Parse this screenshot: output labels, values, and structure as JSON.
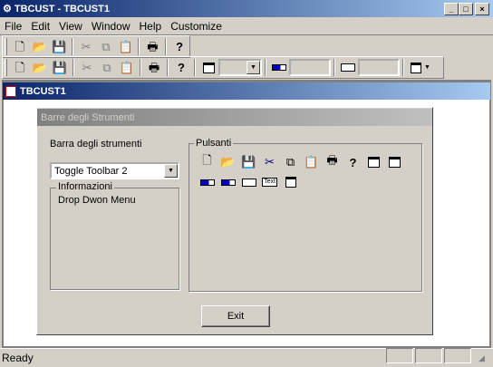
{
  "window": {
    "title": "TBCUST - TBCUST1",
    "min": "_",
    "max": "□",
    "close": "×"
  },
  "menu": [
    "File",
    "Edit",
    "View",
    "Window",
    "Help",
    "Customize"
  ],
  "toolbar1": {
    "icons": [
      "new-icon",
      "open-icon",
      "save-icon",
      "cut-icon",
      "copy-icon",
      "paste-icon",
      "print-icon",
      "help-icon"
    ]
  },
  "toolbar2": {
    "icons": [
      "new-icon",
      "open-icon",
      "save-icon",
      "cut-icon",
      "copy-icon",
      "paste-icon",
      "print-icon",
      "help-icon",
      "frame-icon",
      "combo",
      "progress-icon",
      "edit",
      "rect-icon",
      "edit",
      "dropdown-menu-icon"
    ]
  },
  "child": {
    "title": "TBCUST1"
  },
  "dialog": {
    "title": "Barre degli Strumenti",
    "toolbar_label": "Barra degli strumenti",
    "toolbar_select": "Toggle Toolbar 2",
    "info_label": "Informazioni",
    "info_text": "Drop Dwon Menu",
    "buttons_label": "Pulsanti",
    "text_button": "Text",
    "exit": "Exit"
  },
  "status": {
    "text": "Ready"
  }
}
